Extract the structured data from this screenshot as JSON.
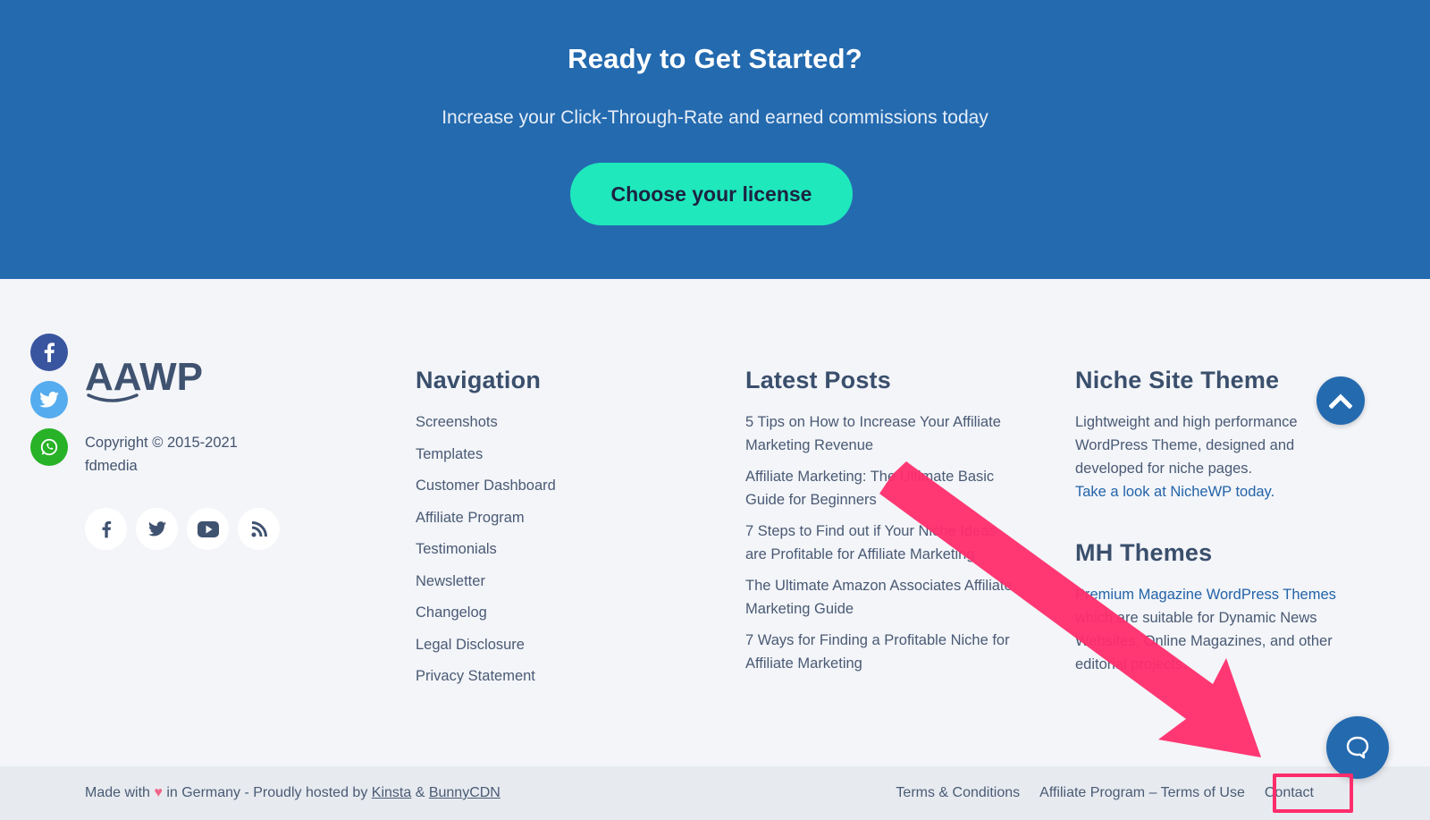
{
  "cta": {
    "title": "Ready to Get Started?",
    "subtitle": "Increase your Click-Through-Rate and earned commissions today",
    "button_label": "Choose your license"
  },
  "share_rail": [
    {
      "icon": "facebook-icon",
      "color": "#3a559f"
    },
    {
      "icon": "twitter-icon",
      "color": "#55acee"
    },
    {
      "icon": "whatsapp-icon",
      "color": "#28b227"
    }
  ],
  "brand": {
    "logo_text": "AAWP",
    "copyright_line1": "Copyright © 2015-2021",
    "copyright_line2": "fdmedia",
    "social": [
      "facebook-icon",
      "twitter-icon",
      "youtube-icon",
      "rss-icon"
    ]
  },
  "navigation": {
    "heading": "Navigation",
    "items": [
      "Screenshots",
      "Templates",
      "Customer Dashboard",
      "Affiliate Program",
      "Testimonials",
      "Newsletter",
      "Changelog",
      "Legal Disclosure",
      "Privacy Statement"
    ]
  },
  "latest_posts": {
    "heading": "Latest Posts",
    "items": [
      "5 Tips on How to Increase Your Affiliate Marketing Revenue",
      "Affiliate Marketing: The Ultimate Basic Guide for Beginners",
      "7 Steps to Find out if Your Niche Ideas are Profitable for Affiliate Marketing",
      "The Ultimate Amazon Associates Affiliate Marketing Guide",
      "7 Ways for Finding a Profitable Niche for Affiliate Marketing"
    ]
  },
  "niche_site": {
    "heading": "Niche Site Theme",
    "text": "Lightweight and high performance WordPress Theme, designed and developed for niche pages.",
    "link": "Take a look at NicheWP today."
  },
  "mh_themes": {
    "heading": "MH Themes",
    "link": "Premium Magazine WordPress Themes",
    "text": "which are suitable for Dynamic News Websites, Online Magazines, and other editorial projects."
  },
  "bottom_bar": {
    "made_with": "Made with",
    "in_germany": "in Germany - Proudly hosted by",
    "kinsta": "Kinsta",
    "amp": "&",
    "bunnycdn": "BunnyCDN",
    "links": [
      "Terms & Conditions",
      "Affiliate Program – Terms of Use",
      "Contact"
    ]
  },
  "colors": {
    "brand_blue": "#246aaf",
    "cta_button": "#1fe8bd",
    "annotation": "#ff2d6b",
    "footer_bg": "#f3f5f9",
    "bottom_bar_bg": "#e7ebf0"
  }
}
